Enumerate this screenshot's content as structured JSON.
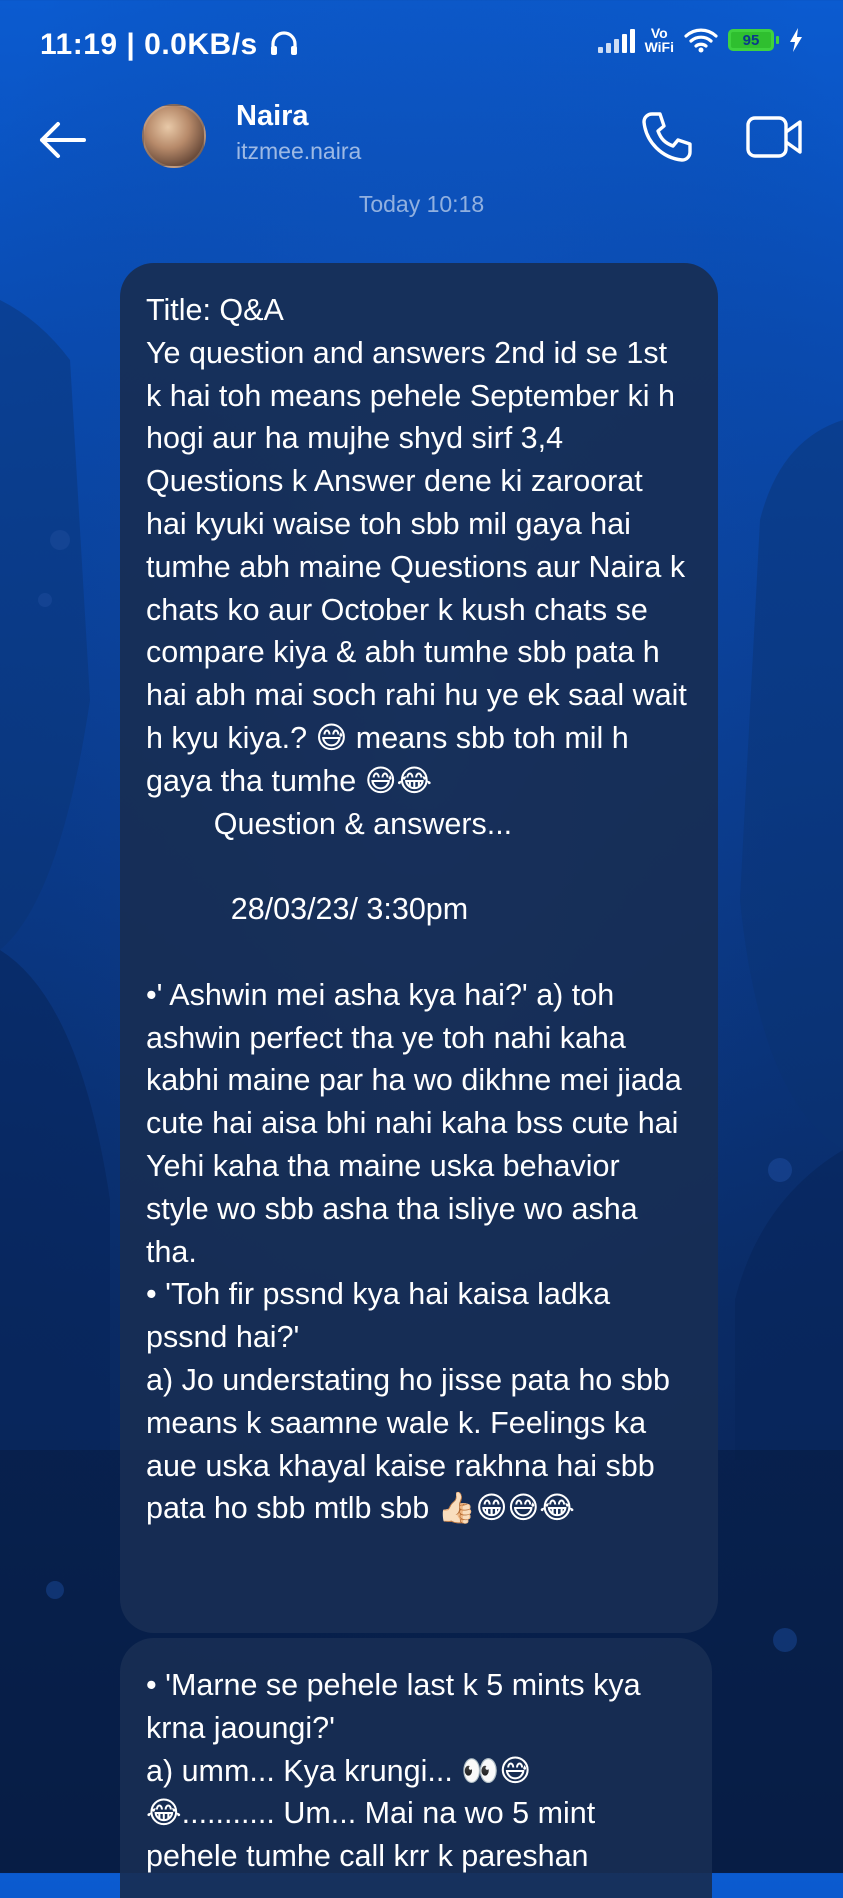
{
  "status_bar": {
    "time": "11:19",
    "network_speed": "0.0KB/s",
    "headphone_icon": "headphones-icon",
    "signal_icon": "signal-bars-icon",
    "vowifi_label": "Vo\nWiFi",
    "wifi_icon": "wifi-icon",
    "battery_level": "95",
    "charging_icon": "bolt-icon"
  },
  "header": {
    "back_icon": "arrow-left-icon",
    "contact_name": "Naira",
    "contact_handle": "itzmee.naira",
    "call_icon": "phone-icon",
    "video_icon": "video-camera-icon"
  },
  "chat": {
    "timestamp": "Today 10:18",
    "messages": [
      {
        "text": "Title: Q&A\nYe question and answers 2nd id se 1st k hai toh means pehele September ki h hogi aur ha mujhe shyd sirf 3,4 Questions k Answer dene ki zaroorat hai kyuki waise toh sbb mil gaya hai tumhe abh maine Questions aur Naira k chats ko aur October k kush chats se compare kiya & abh tumhe sbb pata h hai abh mai soch rahi hu ye ek saal wait h kyu kiya.? 😅 means sbb toh mil h gaya tha tumhe 😅😂\n        Question & answers...\n\n          28/03/23/ 3:30pm\n\n•' Ashwin mei asha kya hai?' a) toh ashwin perfect tha ye toh nahi kaha kabhi maine par ha wo dikhne mei jiada cute hai aisa bhi nahi kaha bss cute hai Yehi kaha tha maine uska behavior style wo sbb asha tha isliye wo asha tha.\n• 'Toh fir pssnd kya hai kaisa ladka pssnd hai?'\na) Jo understating ho jisse pata ho sbb means k saamne wale k. Feelings ka aue uska khayal kaise rakhna hai sbb pata ho sbb mtlb sbb 👍🏻😁😅😂"
      },
      {
        "text": "• 'Marne se pehele last k 5 mints kya krna jaoungi?'\na) umm... Kya krungi... 👀😅\n😂........... Um... Mai na wo 5 mint pehele tumhe call krr k pareshan"
      }
    ]
  },
  "colors": {
    "background_top": "#0b5bd0",
    "background_bottom": "#08204c",
    "bubble": "#182e54",
    "battery": "#3fd23f"
  }
}
